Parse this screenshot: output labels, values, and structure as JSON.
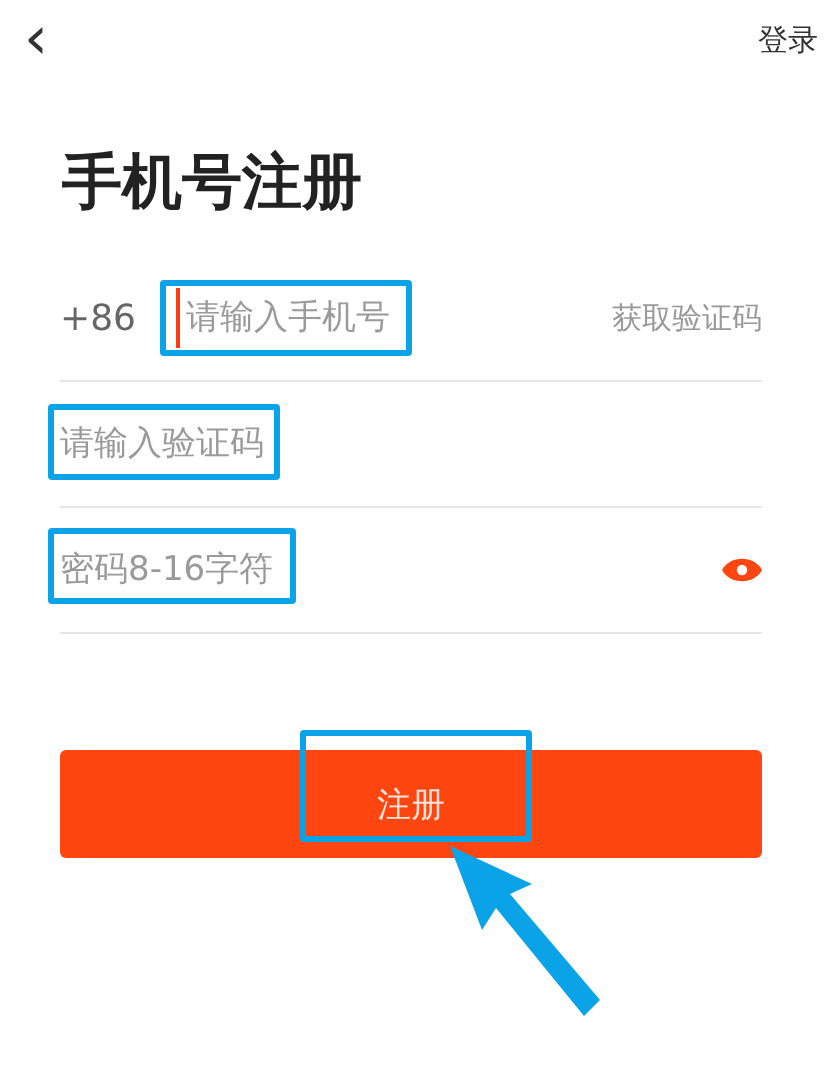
{
  "top_bar": {
    "back": "‹",
    "action": "登录"
  },
  "title": "手机号注册",
  "fields": [
    {
      "kind": "phone",
      "prefix": "+86",
      "placeholder": "请输入手机号",
      "focused": true,
      "action": "获取验证码"
    },
    {
      "kind": "code",
      "placeholder": "请输入验证码",
      "focused": false
    },
    {
      "kind": "password",
      "placeholder": "密码8-16字符",
      "focused": false
    }
  ],
  "submit": {
    "label": "注册",
    "disabled": true
  }
}
